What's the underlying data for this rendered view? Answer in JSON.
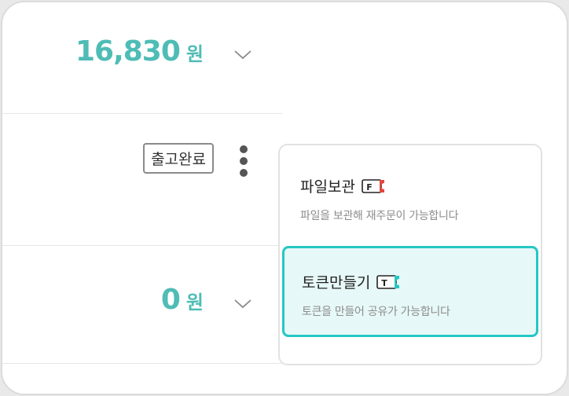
{
  "rows": [
    {
      "amount": "16,830",
      "unit": "원"
    },
    {
      "status": "출고완료"
    },
    {
      "amount": "0",
      "unit": "원"
    }
  ],
  "menu": {
    "items": [
      {
        "title": "파일보관",
        "desc": "파일을 보관해 재주문이 가능합니다",
        "icon": "file-ticket-icon",
        "letter": "F",
        "accent": "#e0473f"
      },
      {
        "title": "토큰만들기",
        "desc": "토큰을 만들어 공유가 가능합니다",
        "icon": "token-ticket-icon",
        "letter": "T",
        "accent": "#26c7c4"
      }
    ]
  },
  "colors": {
    "price": "#4fbcb6",
    "highlight_border": "#26c7c4",
    "highlight_bg": "#e6f8f7"
  }
}
